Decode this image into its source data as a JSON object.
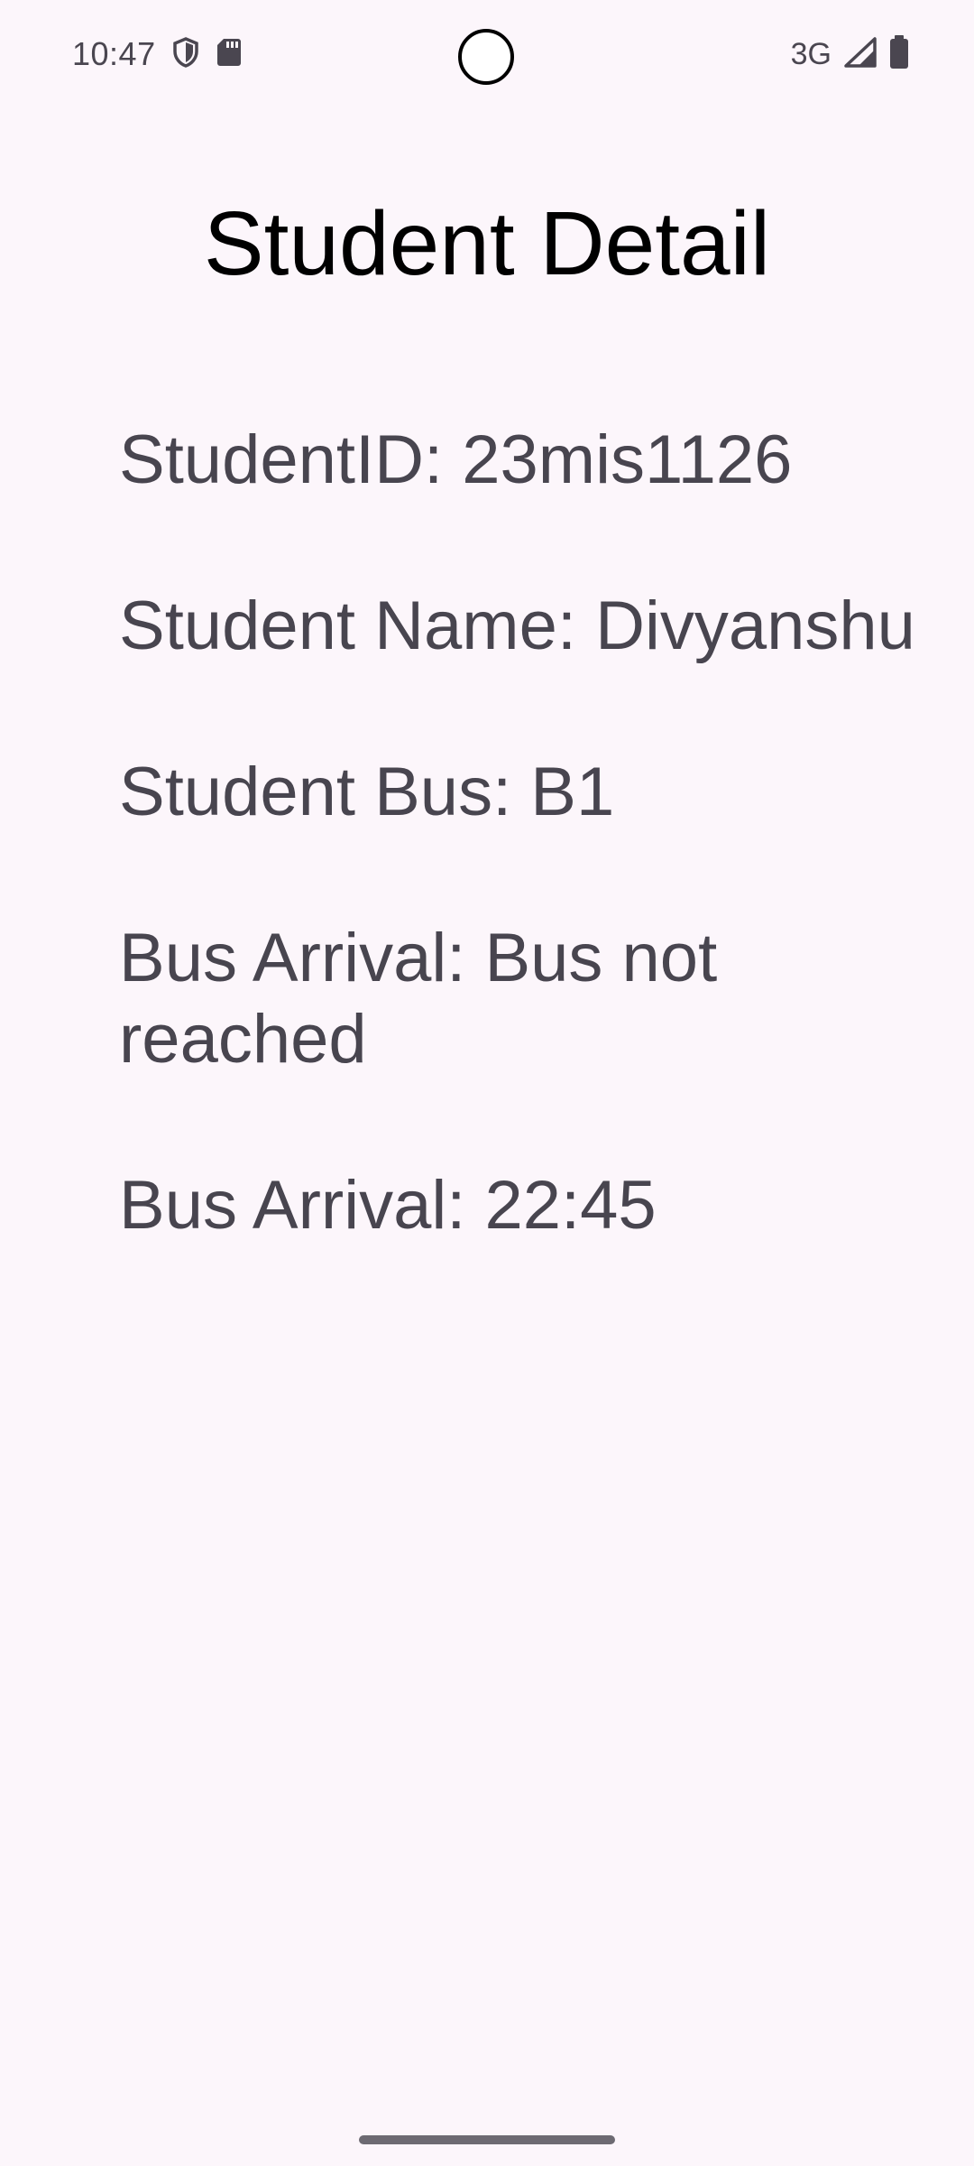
{
  "status_bar": {
    "time": "10:47",
    "left_icons": [
      "shield-icon",
      "sd-card-icon"
    ],
    "network_type": "3G",
    "right_icons": [
      "signal-icon",
      "battery-icon"
    ]
  },
  "page": {
    "title": "Student Detail"
  },
  "details": {
    "student_id": "StudentID: 23mis1126",
    "student_name": "Student Name: Divyanshu",
    "student_bus": "Student Bus: B1",
    "bus_arrival_status": "Bus Arrival: Bus not reached",
    "bus_arrival_time": "Bus Arrival: 22:45"
  },
  "colors": {
    "background": "#FCF6FB",
    "title_text": "#000000",
    "detail_text": "#48454F"
  }
}
